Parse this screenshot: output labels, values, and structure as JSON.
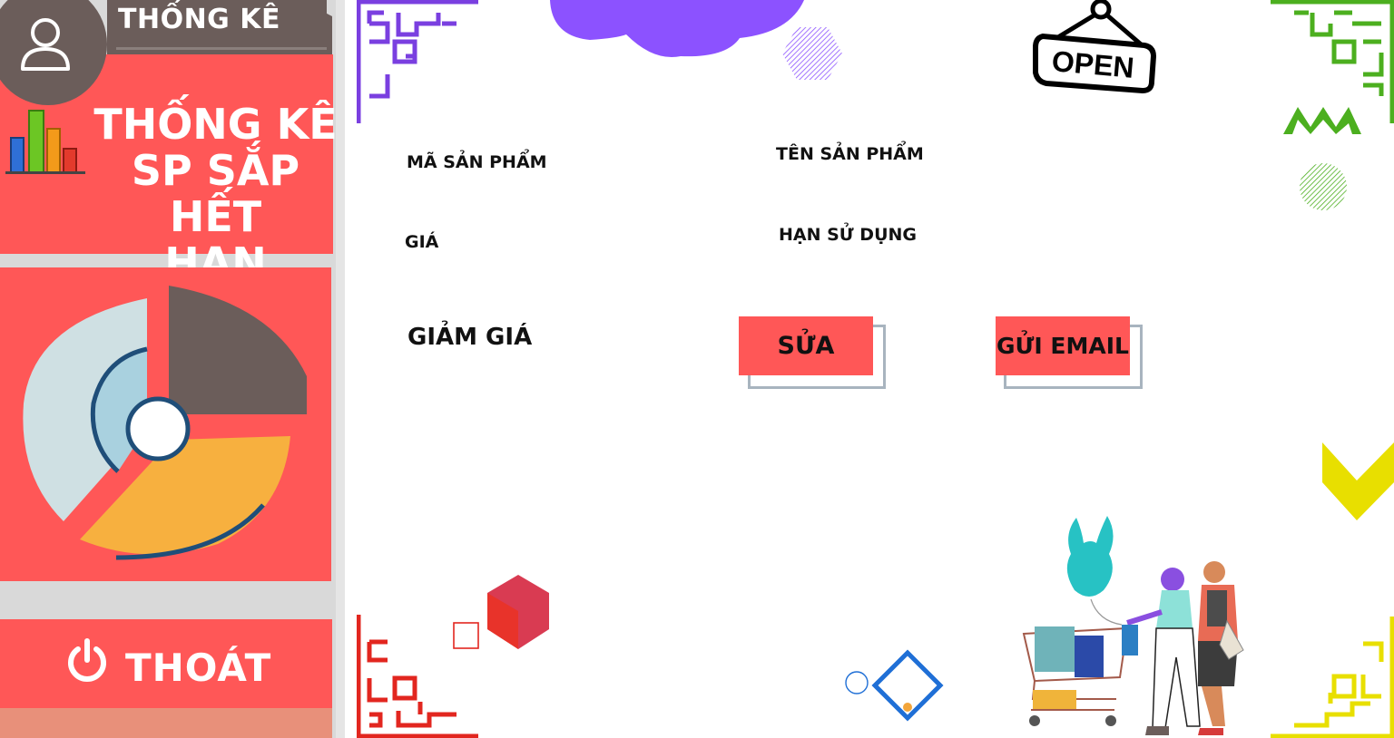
{
  "sidebar": {
    "top_tab_label": "THỐNG KÊ",
    "title_lines": [
      "THỐNG KÊ",
      "SP SẮP HẾT",
      "HẠN"
    ],
    "exit_label": "THOÁT"
  },
  "form": {
    "ma_san_pham_label": "MÃ SẢN PHẨM",
    "ten_san_pham_label": "TÊN SẢN PHẨM",
    "gia_label": "GIÁ",
    "han_su_dung_label": "HẠN SỬ DỤNG",
    "giam_gia_label": "GIẢM GIÁ",
    "sua_button_label": "SỬA",
    "gui_email_button_label": "GỬI EMAIL"
  },
  "decor": {
    "open_sign_text": "OPEN"
  },
  "colors": {
    "accent": "#ff5757",
    "dark": "#6b5d5a",
    "purple": "#8c52ff",
    "green": "#4caf1f",
    "yellow": "#e8df00"
  }
}
